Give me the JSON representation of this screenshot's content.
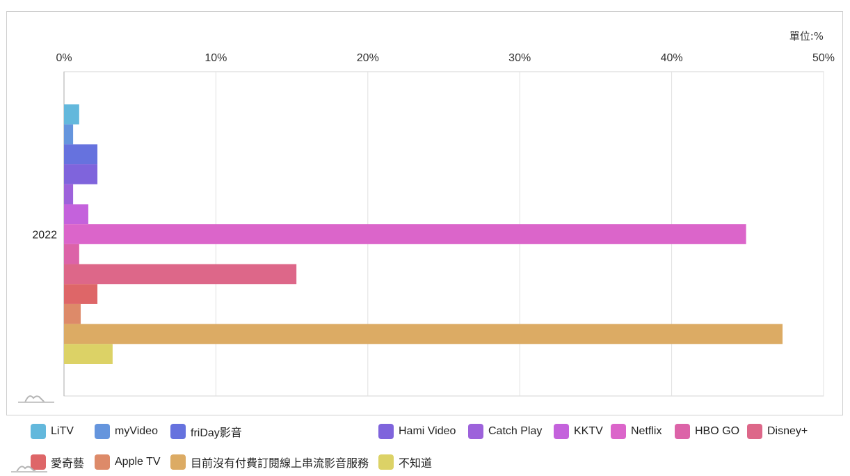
{
  "chart_data": {
    "type": "bar",
    "orientation": "horizontal",
    "unit_label": "單位:%",
    "categories": [
      "2022"
    ],
    "xlim": [
      0,
      50
    ],
    "xticks": [
      "0%",
      "10%",
      "20%",
      "30%",
      "40%",
      "50%"
    ],
    "xtick_values": [
      0,
      10,
      20,
      30,
      40,
      50
    ],
    "grid": true,
    "legend_position": "bottom",
    "series": [
      {
        "name": "LiTV",
        "color": "#63b8dc",
        "values": [
          1.0
        ]
      },
      {
        "name": "myVideo",
        "color": "#6595dd",
        "values": [
          0.6
        ]
      },
      {
        "name": "friDay影音",
        "color": "#6672de",
        "values": [
          2.2
        ]
      },
      {
        "name": "Hami Video",
        "color": "#7f64dc",
        "values": [
          2.2
        ]
      },
      {
        "name": "Catch Play",
        "color": "#9d62db",
        "values": [
          0.6
        ]
      },
      {
        "name": "KKTV",
        "color": "#c462dc",
        "values": [
          1.6
        ]
      },
      {
        "name": "Netflix",
        "color": "#db65ca",
        "values": [
          44.9
        ]
      },
      {
        "name": "HBO GO",
        "color": "#dc63a8",
        "values": [
          1.0
        ]
      },
      {
        "name": "Disney+",
        "color": "#dd6789",
        "values": [
          15.3
        ]
      },
      {
        "name": "愛奇藝",
        "color": "#de6668",
        "values": [
          2.2
        ]
      },
      {
        "name": "Apple TV",
        "color": "#dd8a69",
        "values": [
          1.1
        ]
      },
      {
        "name": "目前沒有付費訂閱線上串流影音服務",
        "color": "#dcab64",
        "values": [
          47.3
        ]
      },
      {
        "name": "不知道",
        "color": "#dcd266",
        "values": [
          3.2
        ]
      }
    ]
  }
}
